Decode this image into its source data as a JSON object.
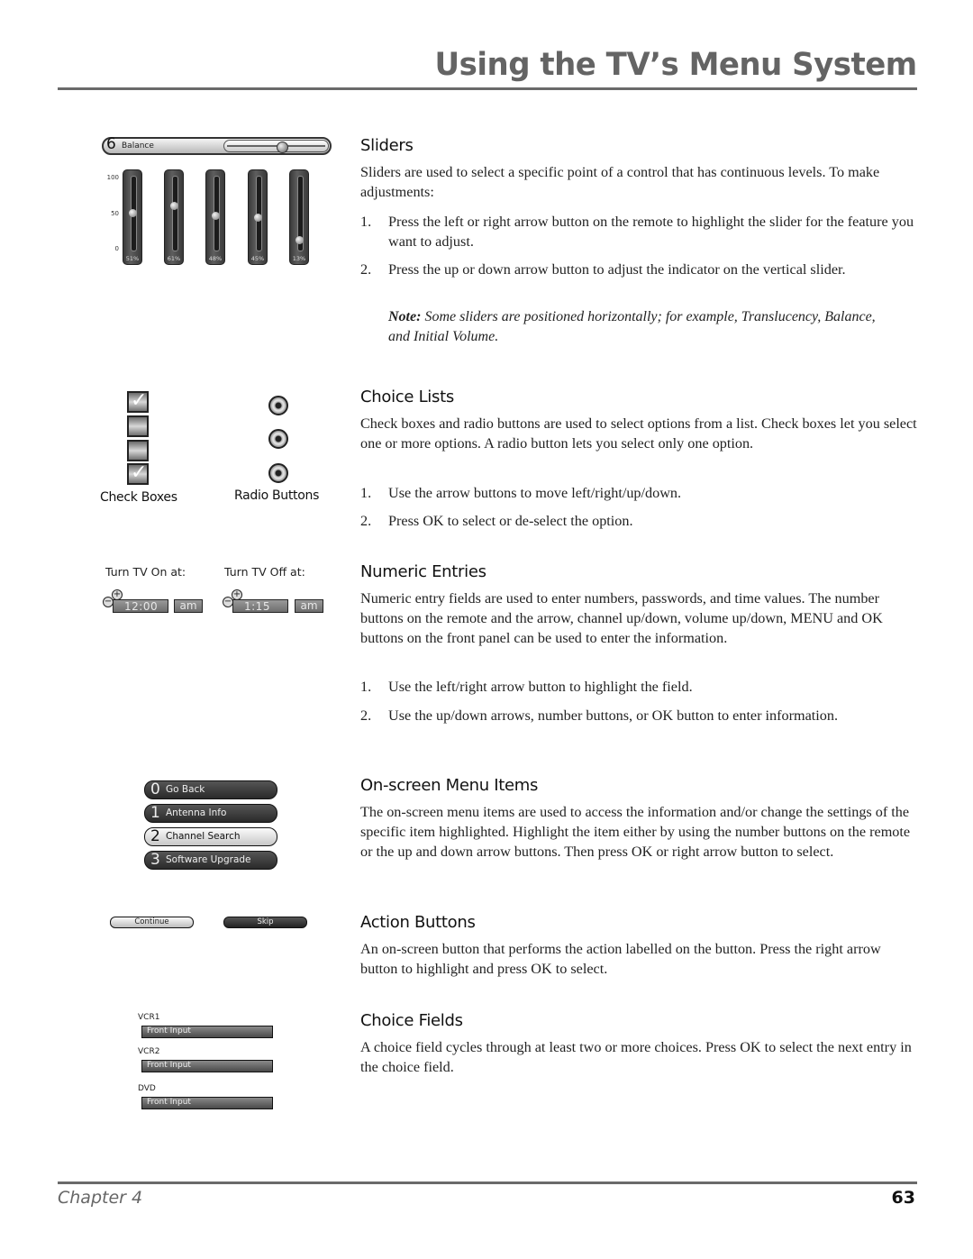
{
  "header": {
    "title": "Using the TV’s Menu System"
  },
  "footer": {
    "chapter": "Chapter 4",
    "page_number": "63"
  },
  "illustrations": {
    "balance_slider": {
      "number": "6",
      "label": "Balance",
      "value_fraction": 0.55
    },
    "vertical_sliders": {
      "axis_ticks": [
        "100",
        "50",
        "0"
      ],
      "sliders": [
        {
          "value": 51,
          "label": "51%"
        },
        {
          "value": 61,
          "label": "61%"
        },
        {
          "value": 48,
          "label": "48%"
        },
        {
          "value": 45,
          "label": "45%"
        },
        {
          "value": 13,
          "label": "13%"
        }
      ]
    },
    "check_boxes": {
      "caption": "Check Boxes",
      "items": [
        {
          "checked": true
        },
        {
          "checked": false
        },
        {
          "checked": false
        },
        {
          "checked": true
        }
      ],
      "check_glyph": "✓"
    },
    "radio_buttons": {
      "caption": "Radio Buttons",
      "count": 3
    },
    "numeric_entries": [
      {
        "label": "Turn TV On at:",
        "time": "12:00",
        "ampm": "am",
        "plus": "+",
        "minus": "−"
      },
      {
        "label": "Turn TV Off at:",
        "time": "1:15",
        "ampm": "am",
        "plus": "+",
        "minus": "−"
      }
    ],
    "menu_items": [
      {
        "number": "0",
        "label": "Go Back",
        "selected": false
      },
      {
        "number": "1",
        "label": "Antenna Info",
        "selected": false
      },
      {
        "number": "2",
        "label": "Channel Search",
        "selected": true
      },
      {
        "number": "3",
        "label": "Software Upgrade",
        "selected": false
      }
    ],
    "action_buttons": {
      "continue_label": "Continue",
      "skip_label": "Skip"
    },
    "choice_fields": [
      {
        "label": "VCR1",
        "value": "Front Input"
      },
      {
        "label": "VCR2",
        "value": "Front Input"
      },
      {
        "label": "DVD",
        "value": "Front Input"
      }
    ]
  },
  "sections": {
    "sliders": {
      "heading": "Sliders",
      "intro": "Sliders are used to select a specific point of a control that has continuous levels. To make adjustments:",
      "steps": [
        {
          "num": "1.",
          "text": "Press the left or right arrow button on the remote to highlight the slider for the feature you want to adjust."
        },
        {
          "num": "2.",
          "text": "Press the up or down arrow button to adjust the indicator on the vertical slider."
        }
      ],
      "note_label": "Note:",
      "note_text": " Some sliders are positioned horizontally; for example, Translucency, Balance, and Initial Volume."
    },
    "choice_lists": {
      "heading": "Choice Lists",
      "intro": "Check boxes and radio buttons are used to select options from a list. Check boxes let you select one or more options. A radio button lets you select only one option.",
      "steps": [
        {
          "num": "1.",
          "text": "Use the arrow buttons to move left/right/up/down."
        },
        {
          "num": "2.",
          "text": "Press OK to select or de-select the option."
        }
      ]
    },
    "numeric_entries": {
      "heading": "Numeric Entries",
      "intro": "Numeric entry fields are used to enter numbers, passwords, and time values. The number buttons on the remote and the arrow, channel up/down, volume up/down,  MENU and OK buttons on the front panel can be used to enter the information.",
      "steps": [
        {
          "num": "1.",
          "text": "Use the left/right arrow button to highlight the field."
        },
        {
          "num": "2.",
          "text": "Use the up/down arrows, number buttons, or OK button to enter information."
        }
      ]
    },
    "menu_items": {
      "heading": "On-screen Menu Items",
      "intro": "The on-screen menu items are used to access the information and/or change the settings of the specific item highlighted.  Highlight the item either by using the number buttons on the remote or the up and down arrow buttons. Then press OK or right arrow button to select."
    },
    "action_buttons": {
      "heading": "Action Buttons",
      "intro": "An on-screen button that performs the action labelled on the button. Press the right arrow button to highlight and press OK to select."
    },
    "choice_fields": {
      "heading": "Choice Fields",
      "intro": "A choice field cycles through at least two or more choices. Press OK to select the next entry in the choice field."
    }
  }
}
